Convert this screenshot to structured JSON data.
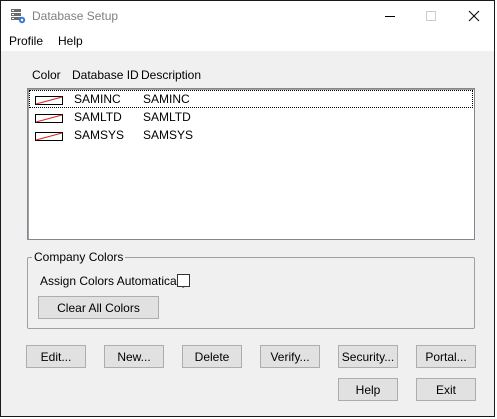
{
  "window": {
    "title": "Database Setup",
    "icon": "database-gear-icon"
  },
  "menu": {
    "profile": "Profile",
    "help": "Help"
  },
  "list": {
    "columns": {
      "color": "Color",
      "id": "Database ID",
      "description": "Description"
    },
    "rows": [
      {
        "id": "SAMINC",
        "description": "SAMINC",
        "color": "none"
      },
      {
        "id": "SAMLTD",
        "description": "SAMLTD",
        "color": "none"
      },
      {
        "id": "SAMSYS",
        "description": "SAMSYS",
        "color": "none"
      }
    ]
  },
  "company_colors": {
    "title": "Company Colors",
    "assign_auto_label": "Assign Colors Automatically",
    "assign_auto_checked": false,
    "clear_button": "Clear All Colors"
  },
  "buttons": {
    "edit": "Edit...",
    "new": "New...",
    "delete": "Delete",
    "verify": "Verify...",
    "security": "Security...",
    "portal": "Portal...",
    "help": "Help",
    "exit": "Exit"
  },
  "colors": {
    "no_color_slash": "#e02020",
    "button_face": "#e1e1e1",
    "window_bg": "#f0f0f0"
  }
}
